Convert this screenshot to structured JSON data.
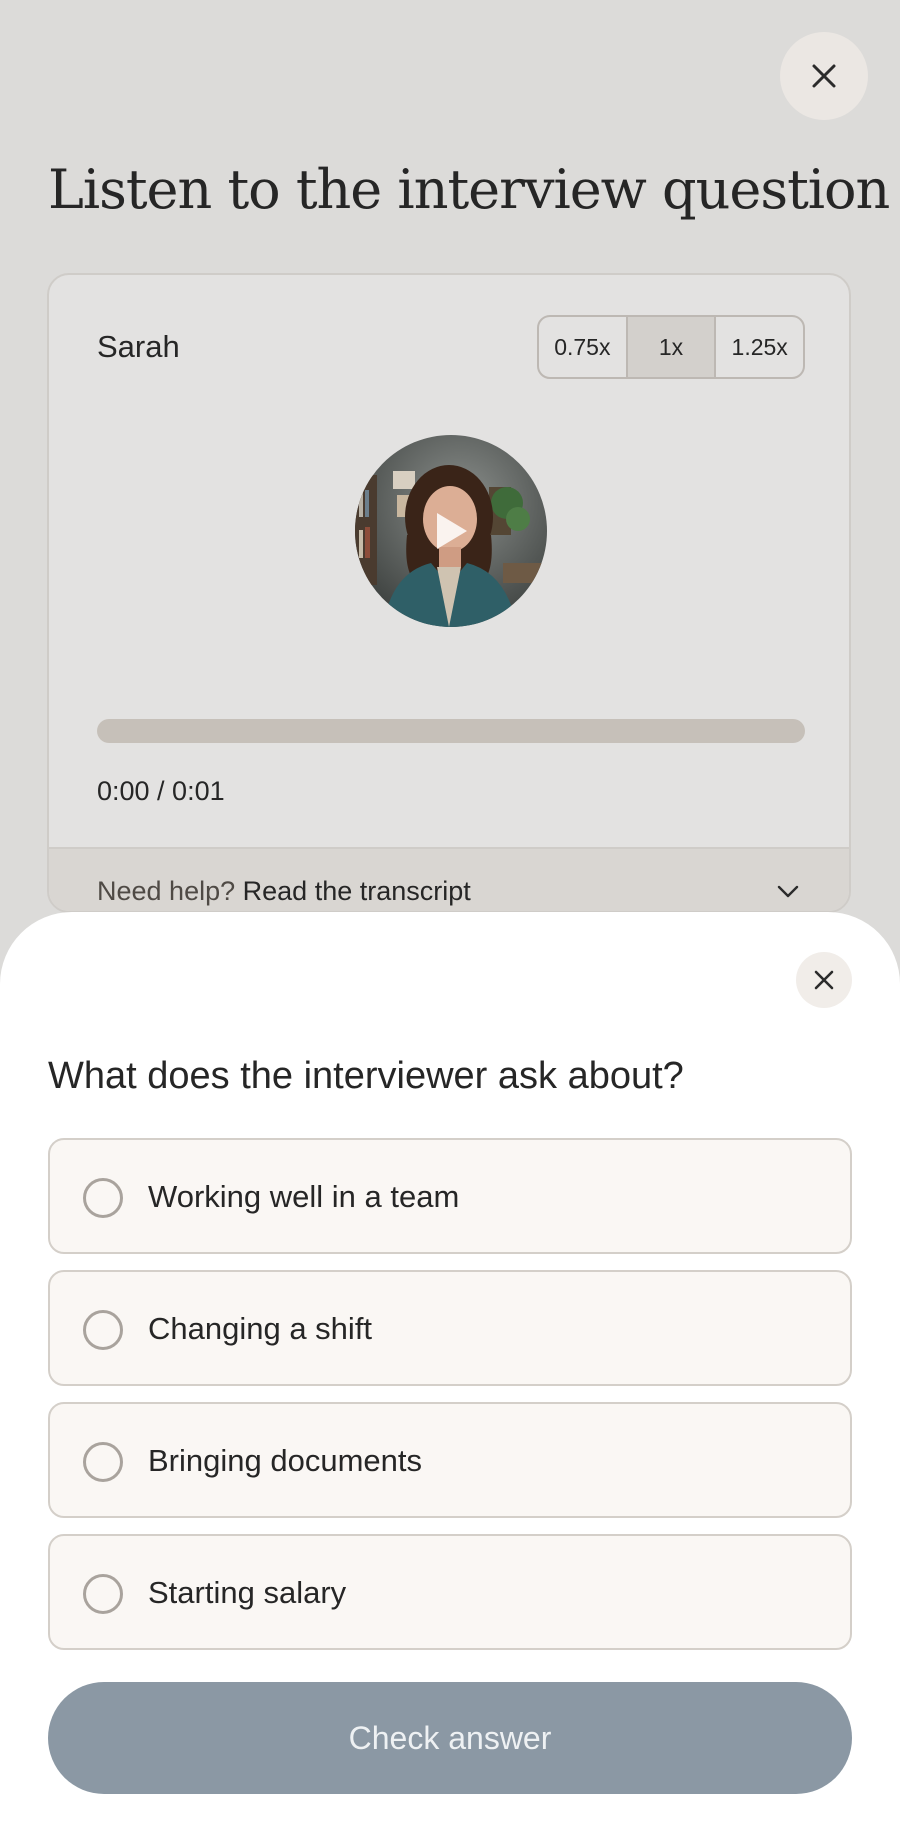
{
  "page": {
    "title": "Listen to the interview question"
  },
  "player": {
    "speaker": "Sarah",
    "speeds": [
      "0.75x",
      "1x",
      "1.25x"
    ],
    "selected_speed": "1x",
    "time": "0:00 / 0:01",
    "progress": 0,
    "avatar_alt": "Interviewer Sarah",
    "transcript": {
      "prompt": "Need help?",
      "link": "Read the transcript"
    }
  },
  "sheet": {
    "question": "What does the interviewer ask about?",
    "options": [
      "Working well in a team",
      "Changing a shift",
      "Bringing documents",
      "Starting salary"
    ],
    "check_label": "Check answer",
    "check_enabled": false
  },
  "icons": {
    "close": "close-icon",
    "play": "play-icon",
    "chevron": "chevron-down-icon",
    "radio": "radio-unselected"
  },
  "colors": {
    "page_bg": "#dcdbd9",
    "card_bg": "#e3e2e1",
    "progress_track": "#c6c0b9",
    "option_bg": "#faf7f4",
    "button_disabled": "#8b98a4"
  }
}
